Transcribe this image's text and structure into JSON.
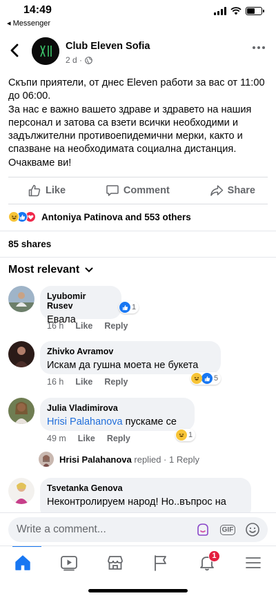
{
  "status_bar": {
    "time": "14:49",
    "back_app": "◂ Messenger"
  },
  "header": {
    "page_name": "Club Eleven Sofia",
    "meta": "2 d ·",
    "avatar_text": "XI"
  },
  "post": {
    "text": "Скъпи приятели, от днес Eleven работи за вас от 11:00\nдо 06:00.\nЗа нас е важно вашето здраве и здравето на нашия\nперсонал и затова са взети всички необходими и\nзадължителни противоепидемични мерки, както и\nспазване на необходимата социална дистанция.\nОчакваме ви!"
  },
  "actions": {
    "like": "Like",
    "comment": "Comment",
    "share": "Share"
  },
  "reactions": {
    "summary": "Antoniya Patinova and 553 others",
    "types": [
      "haha",
      "like",
      "love"
    ]
  },
  "shares": "85 shares",
  "sort_label": "Most relevant",
  "comments": [
    {
      "name": "Lyubomir Rusev",
      "text": "Евала",
      "time": "16 h",
      "like": "Like",
      "reply": "Reply",
      "reaction_count": "1",
      "reaction_type": "like"
    },
    {
      "name": "Zhivko Avramov",
      "text": "Искам да гушна моета не букета",
      "time": "16 h",
      "like": "Like",
      "reply": "Reply",
      "reaction_count": "5",
      "reaction_type": "haha+like"
    },
    {
      "name": "Julia Vladimirova",
      "mention": "Hrisi Palahanova",
      "text": " пускаме се",
      "time": "49 m",
      "like": "Like",
      "reply": "Reply",
      "reaction_count": "1",
      "reaction_type": "haha"
    },
    {
      "name": "Tsvetanka Genova",
      "text": "Неконтролируем народ! Но..въпрос на"
    }
  ],
  "reply_thread": {
    "name": "Hrisi Palahanova",
    "action": " replied · 1 Reply"
  },
  "composer": {
    "placeholder": "Write a comment...",
    "gif": "GIF"
  },
  "tabs": {
    "notifications_badge": "1"
  },
  "colors": {
    "brand_blue": "#1877f2",
    "mention_blue": "#216fdb",
    "badge_red": "#e41e3f",
    "bubble_grey": "#f0f2f5",
    "secondary_text": "#65676b"
  }
}
